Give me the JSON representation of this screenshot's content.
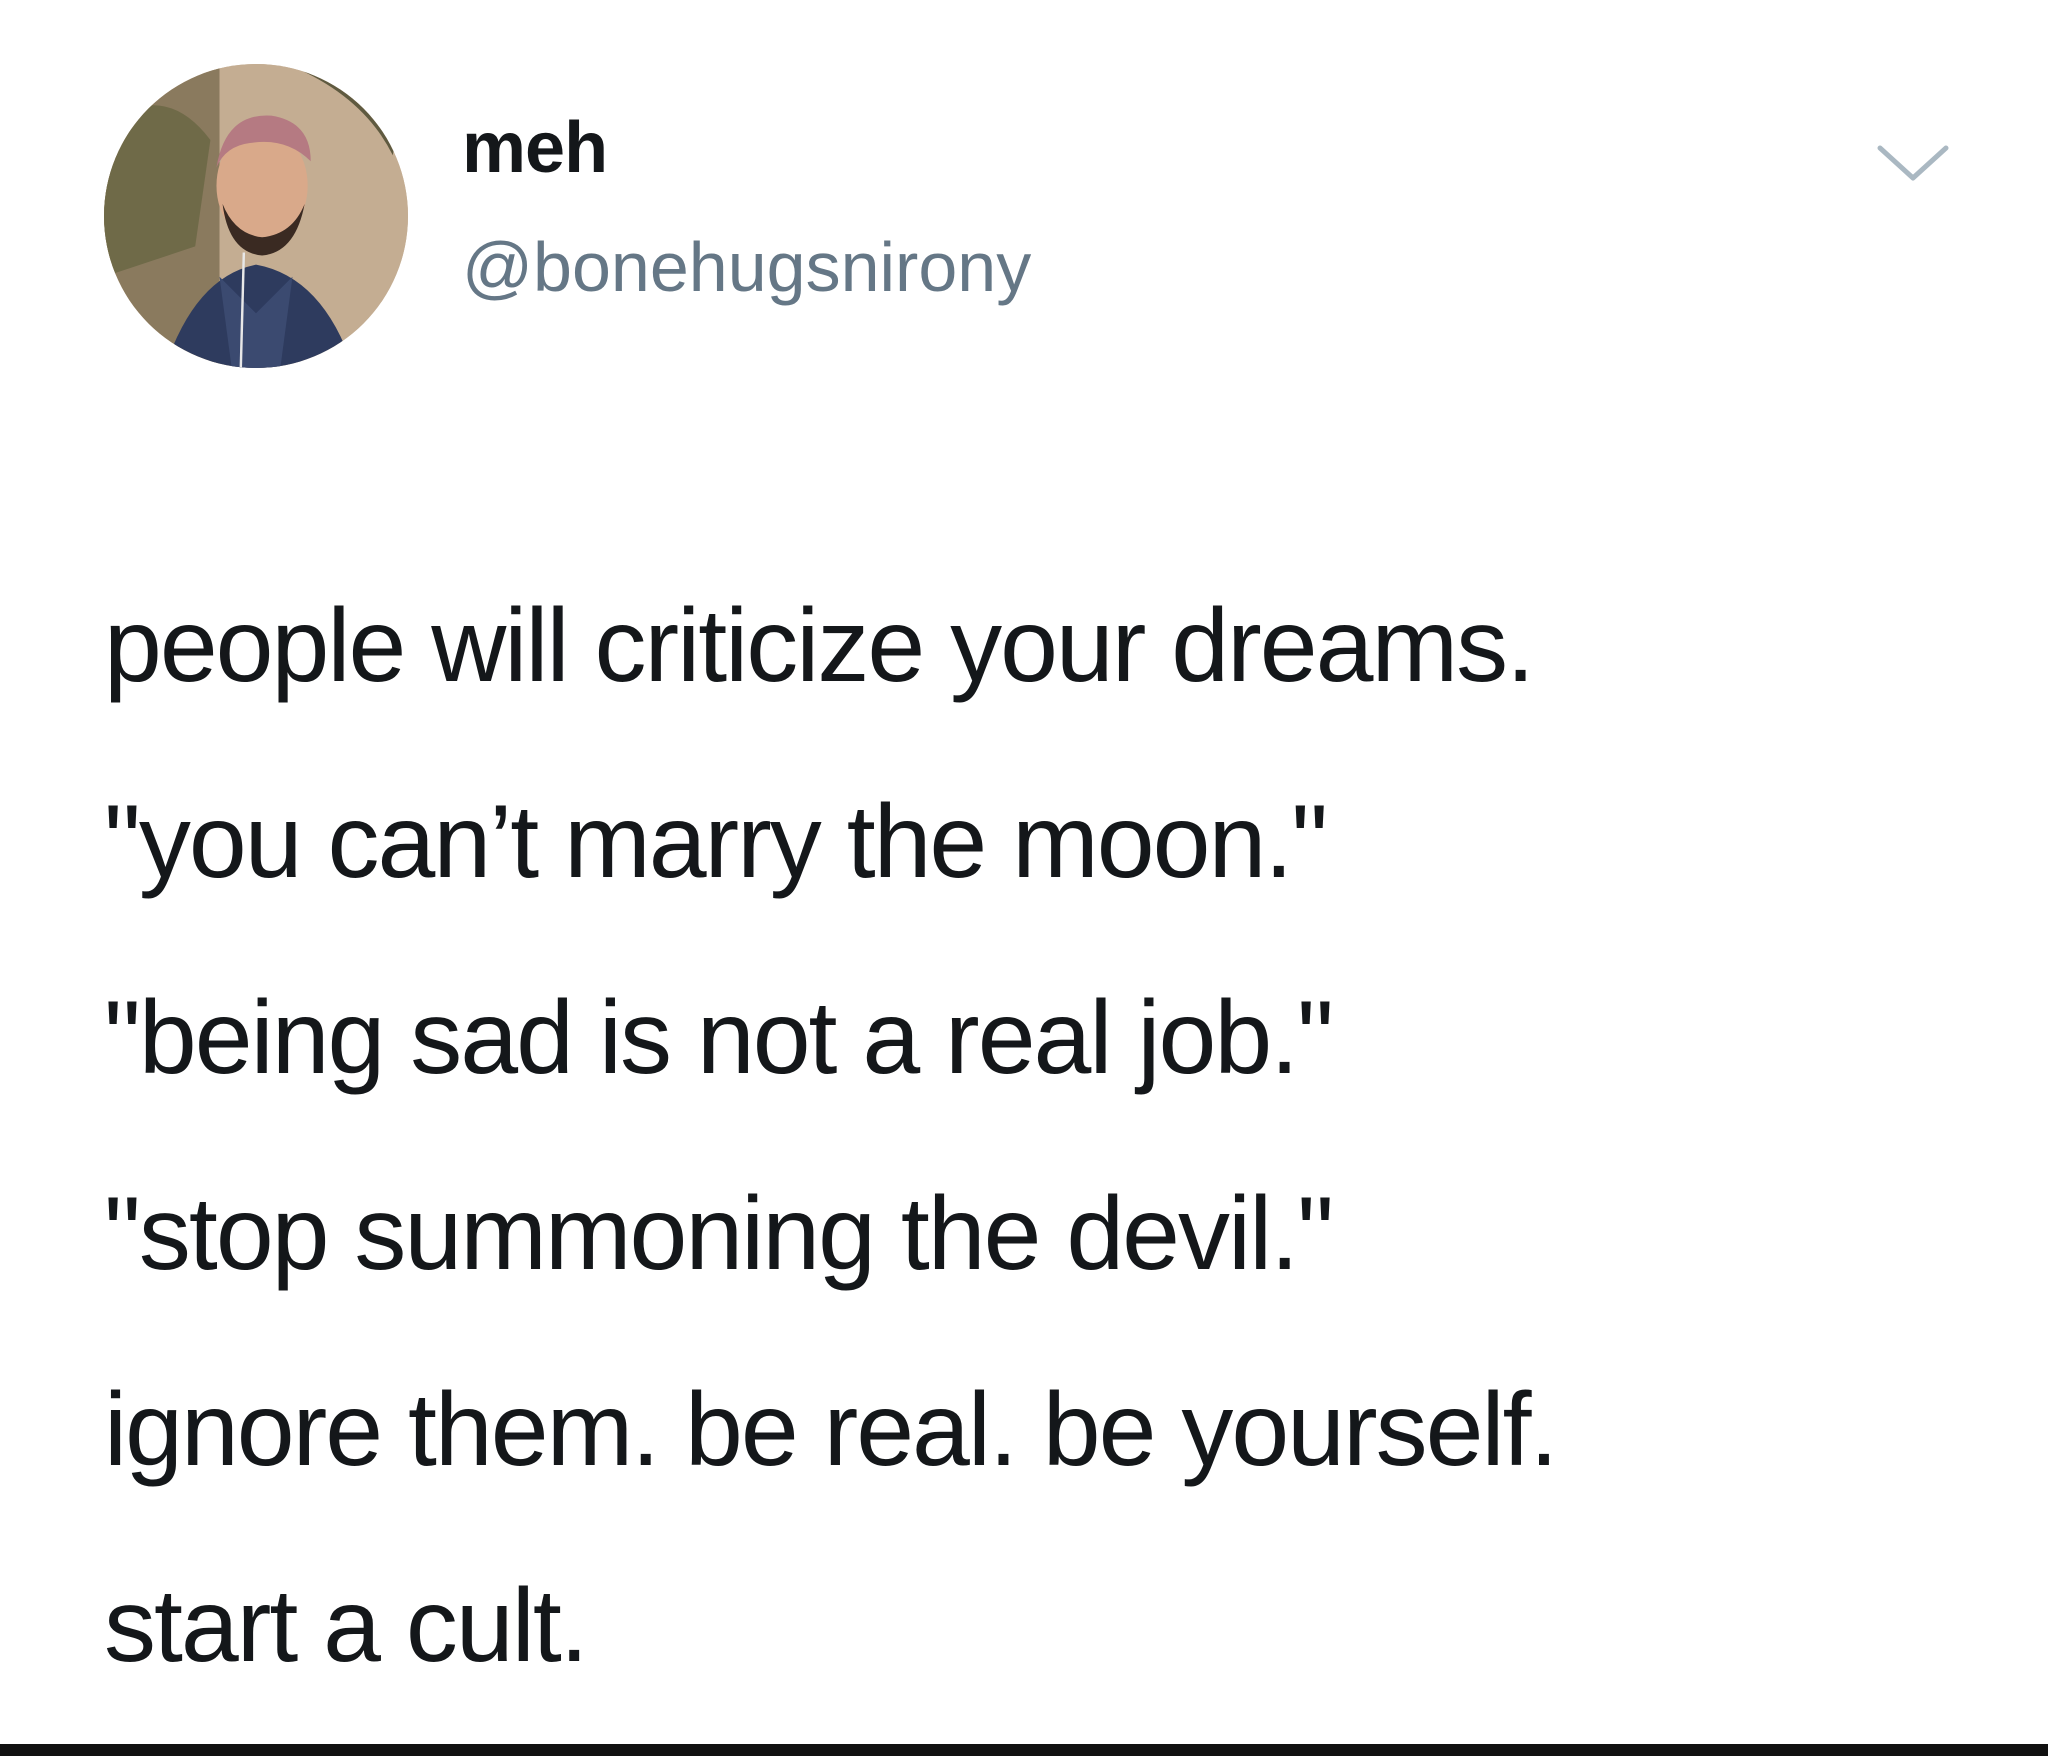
{
  "tweet": {
    "author": {
      "display_name": "meh",
      "handle": "@bonehugsnirony",
      "avatar_icon": "user-avatar-photo"
    },
    "menu_icon": "chevron-down-icon",
    "text_lines": [
      "people will criticize your dreams.",
      "\"you can’t marry the moon.\"",
      "\"being sad is not a real job.\"",
      "\"stop summoning the devil.\"",
      "ignore them. be real. be yourself.",
      "start a cult."
    ]
  },
  "colors": {
    "background": "#ffffff",
    "text_primary": "#14171a",
    "text_secondary": "#657786",
    "caret": "#aab8c2"
  }
}
